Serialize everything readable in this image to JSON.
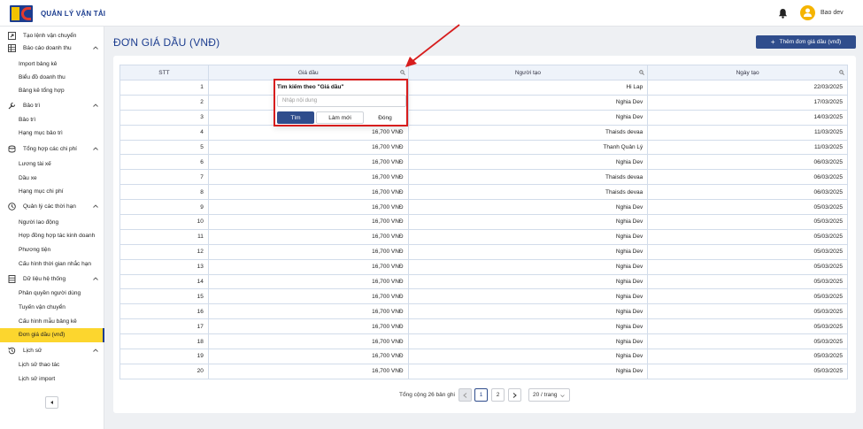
{
  "header": {
    "app_title": "QUẢN LÝ VẬN TẢI",
    "user_name": "Bao dev"
  },
  "sidebar": {
    "rows": [
      {
        "type": "group",
        "label": "Tạo lệnh vận chuyển",
        "icon": "external-link-icon",
        "chevron": false
      },
      {
        "type": "group",
        "label": "Báo cáo doanh thu",
        "icon": "table-icon",
        "chevron": true
      },
      {
        "type": "item",
        "label": "Import bảng kê"
      },
      {
        "type": "item",
        "label": "Biểu đồ doanh thu"
      },
      {
        "type": "item",
        "label": "Bảng kê tổng hợp"
      },
      {
        "type": "group",
        "label": "Bảo trì",
        "icon": "wrench-icon",
        "chevron": true
      },
      {
        "type": "item",
        "label": "Bảo trì"
      },
      {
        "type": "item",
        "label": "Hạng mục bảo trì"
      },
      {
        "type": "group",
        "label": "Tổng hợp các chi phí",
        "icon": "coins-icon",
        "chevron": true
      },
      {
        "type": "item",
        "label": "Lương tài xế"
      },
      {
        "type": "item",
        "label": "Dầu xe"
      },
      {
        "type": "item",
        "label": "Hạng mục chi phí"
      },
      {
        "type": "group",
        "label": "Quản lý các thời hạn",
        "icon": "clock-icon",
        "chevron": true
      },
      {
        "type": "item",
        "label": "Người lao động"
      },
      {
        "type": "item",
        "label": "Hợp đồng hợp tác kinh doanh"
      },
      {
        "type": "item",
        "label": "Phương tiện"
      },
      {
        "type": "item",
        "label": "Cấu hình thời gian nhắc hạn"
      },
      {
        "type": "group",
        "label": "Dữ liệu hệ thống",
        "icon": "database-icon",
        "chevron": true
      },
      {
        "type": "item",
        "label": "Phân quyền người dùng"
      },
      {
        "type": "item",
        "label": "Tuyến vận chuyển"
      },
      {
        "type": "item",
        "label": "Cấu hình mẫu bảng kê"
      },
      {
        "type": "item",
        "label": "Đơn giá dầu (vnđ)",
        "active": true
      },
      {
        "type": "group",
        "label": "Lịch sử",
        "icon": "history-icon",
        "chevron": true
      },
      {
        "type": "item",
        "label": "Lịch sử thao tác"
      },
      {
        "type": "item",
        "label": "Lịch sử import"
      }
    ]
  },
  "main": {
    "page_title": "ĐƠN GIÁ DẦU (VNĐ)",
    "add_button_label": "Thêm đơn giá dầu (vnđ)"
  },
  "table": {
    "columns": [
      "STT",
      "Giá dầu",
      "Người tạo",
      "Ngày tạo"
    ],
    "rows": [
      [
        "1",
        "",
        "Hi Lap",
        "22/03/2025"
      ],
      [
        "2",
        "",
        "Nghia Dev",
        "17/03/2025"
      ],
      [
        "3",
        "",
        "Nghia Dev",
        "14/03/2025"
      ],
      [
        "4",
        "16,700 VNĐ",
        "Thaisds devaa",
        "11/03/2025"
      ],
      [
        "5",
        "16,700 VNĐ",
        "Thanh Quản Lý",
        "11/03/2025"
      ],
      [
        "6",
        "16,700 VNĐ",
        "Nghia Dev",
        "06/03/2025"
      ],
      [
        "7",
        "16,700 VNĐ",
        "Thaisds devaa",
        "06/03/2025"
      ],
      [
        "8",
        "16,700 VNĐ",
        "Thaisds devaa",
        "06/03/2025"
      ],
      [
        "9",
        "16,700 VNĐ",
        "Nghia Dev",
        "05/03/2025"
      ],
      [
        "10",
        "16,700 VNĐ",
        "Nghia Dev",
        "05/03/2025"
      ],
      [
        "11",
        "16,700 VNĐ",
        "Nghia Dev",
        "05/03/2025"
      ],
      [
        "12",
        "16,700 VNĐ",
        "Nghia Dev",
        "05/03/2025"
      ],
      [
        "13",
        "16,700 VNĐ",
        "Nghia Dev",
        "05/03/2025"
      ],
      [
        "14",
        "16,700 VNĐ",
        "Nghia Dev",
        "05/03/2025"
      ],
      [
        "15",
        "16,700 VNĐ",
        "Nghia Dev",
        "05/03/2025"
      ],
      [
        "16",
        "16,700 VNĐ",
        "Nghia Dev",
        "05/03/2025"
      ],
      [
        "17",
        "16,700 VNĐ",
        "Nghia Dev",
        "05/03/2025"
      ],
      [
        "18",
        "16,700 VNĐ",
        "Nghia Dev",
        "05/03/2025"
      ],
      [
        "19",
        "16,700 VNĐ",
        "Nghia Dev",
        "05/03/2025"
      ],
      [
        "20",
        "16,700 VNĐ",
        "Nghia Dev",
        "05/03/2025"
      ]
    ]
  },
  "filter_popover": {
    "title": "Tìm kiếm theo \"Giá dầu\"",
    "placeholder": "Nhập nội dung",
    "search_label": "Tìm",
    "reset_label": "Làm mới",
    "close_label": "Đóng"
  },
  "pagination": {
    "total_text": "Tổng cộng 26 bản ghi",
    "pages": [
      "1",
      "2"
    ],
    "current_page": "1",
    "page_size": "20 / trang"
  },
  "colors": {
    "primary": "#2f4d8c",
    "title_blue": "#1c3d8f",
    "active_yellow": "#fcd62e",
    "annotation_red": "#d71d1d"
  }
}
